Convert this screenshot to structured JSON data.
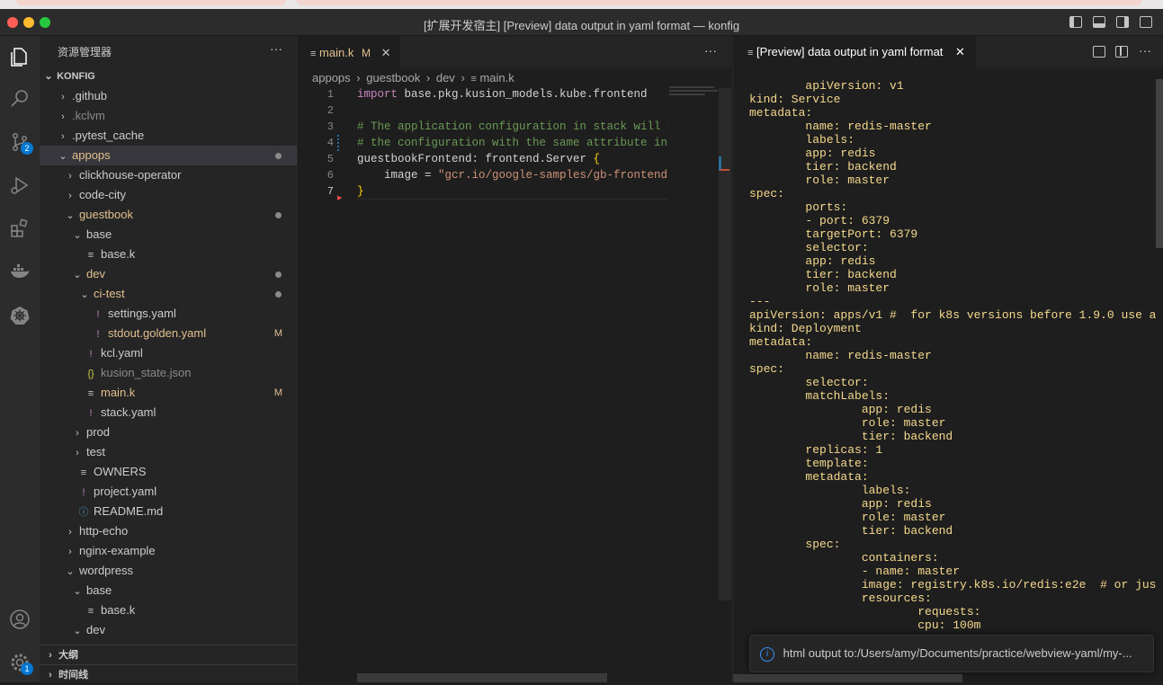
{
  "window": {
    "title": "[扩展开发宿主] [Preview] data output in yaml format — konfig"
  },
  "activity": {
    "scm_badge": "2",
    "settings_badge": "1"
  },
  "sidebar": {
    "header": "资源管理器",
    "root": "KONFIG",
    "tree": [
      {
        "label": ".github",
        "indent": 0,
        "kind": "folder",
        "open": false,
        "color": "#cccccc"
      },
      {
        "label": ".kclvm",
        "indent": 0,
        "kind": "folder",
        "open": false,
        "color": "#8b8b8b"
      },
      {
        "label": ".pytest_cache",
        "indent": 0,
        "kind": "folder",
        "open": false,
        "color": "#cccccc"
      },
      {
        "label": "appops",
        "indent": 0,
        "kind": "folder",
        "open": true,
        "color": "#e2c08d",
        "dot": true,
        "selected": true
      },
      {
        "label": "clickhouse-operator",
        "indent": 1,
        "kind": "folder",
        "open": false,
        "color": "#cccccc"
      },
      {
        "label": "code-city",
        "indent": 1,
        "kind": "folder",
        "open": false,
        "color": "#cccccc"
      },
      {
        "label": "guestbook",
        "indent": 1,
        "kind": "folder",
        "open": true,
        "color": "#e2c08d",
        "dot": true
      },
      {
        "label": "base",
        "indent": 2,
        "kind": "folder",
        "open": true,
        "color": "#cccccc"
      },
      {
        "label": "base.k",
        "indent": 3,
        "kind": "k",
        "color": "#cccccc"
      },
      {
        "label": "dev",
        "indent": 2,
        "kind": "folder",
        "open": true,
        "color": "#e2c08d",
        "dot": true
      },
      {
        "label": "ci-test",
        "indent": 3,
        "kind": "folder",
        "open": true,
        "color": "#e2c08d",
        "dot": true
      },
      {
        "label": "settings.yaml",
        "indent": 4,
        "kind": "yaml",
        "color": "#cccccc"
      },
      {
        "label": "stdout.golden.yaml",
        "indent": 4,
        "kind": "yaml",
        "color": "#e2c08d",
        "mark": "M"
      },
      {
        "label": "kcl.yaml",
        "indent": 3,
        "kind": "yaml",
        "color": "#cccccc"
      },
      {
        "label": "kusion_state.json",
        "indent": 3,
        "kind": "json",
        "color": "#8b8b8b"
      },
      {
        "label": "main.k",
        "indent": 3,
        "kind": "k",
        "color": "#e2c08d",
        "mark": "M"
      },
      {
        "label": "stack.yaml",
        "indent": 3,
        "kind": "yaml",
        "color": "#cccccc"
      },
      {
        "label": "prod",
        "indent": 2,
        "kind": "folder",
        "open": false,
        "color": "#cccccc"
      },
      {
        "label": "test",
        "indent": 2,
        "kind": "folder",
        "open": false,
        "color": "#cccccc"
      },
      {
        "label": "OWNERS",
        "indent": 2,
        "kind": "k",
        "color": "#cccccc"
      },
      {
        "label": "project.yaml",
        "indent": 2,
        "kind": "yaml",
        "color": "#cccccc"
      },
      {
        "label": "README.md",
        "indent": 2,
        "kind": "info",
        "color": "#cccccc"
      },
      {
        "label": "http-echo",
        "indent": 1,
        "kind": "folder",
        "open": false,
        "color": "#cccccc"
      },
      {
        "label": "nginx-example",
        "indent": 1,
        "kind": "folder",
        "open": false,
        "color": "#cccccc"
      },
      {
        "label": "wordpress",
        "indent": 1,
        "kind": "folder",
        "open": true,
        "color": "#cccccc"
      },
      {
        "label": "base",
        "indent": 2,
        "kind": "folder",
        "open": true,
        "color": "#cccccc"
      },
      {
        "label": "base.k",
        "indent": 3,
        "kind": "k",
        "color": "#cccccc"
      },
      {
        "label": "dev",
        "indent": 2,
        "kind": "folder",
        "open": true,
        "color": "#cccccc"
      }
    ],
    "outline_label": "大纲",
    "timeline_label": "时间线"
  },
  "editor": {
    "tab": {
      "label": "main.k",
      "mark": "M"
    },
    "breadcrumb": [
      "appops",
      "guestbook",
      "dev",
      "main.k"
    ],
    "lines": [
      {
        "n": "1",
        "html": "<span style=\"color:#c586c0\">import</span> base.pkg.kusion_models.kube.frontend"
      },
      {
        "n": "2",
        "html": ""
      },
      {
        "n": "3",
        "html": "<span style=\"color:#6a9955\"># The application configuration in stack will ov</span>"
      },
      {
        "n": "4",
        "html": "<span style=\"color:#6a9955\"># the configuration with the same attribute in b</span>"
      },
      {
        "n": "5",
        "html": "guestbookFrontend: frontend.Server <span style=\"color:#ffd700\">{</span>"
      },
      {
        "n": "6",
        "html": "    image = <span style=\"color:#ce9178\">\"gcr.io/google-samples/gb-frontend:v</span>"
      },
      {
        "n": "7",
        "html": "<span style=\"color:#ffd700\">}</span>"
      }
    ]
  },
  "preview": {
    "tab_label": "[Preview] data output in yaml format",
    "yaml_lines": [
      "        apiVersion: v1",
      "kind: Service",
      "metadata:",
      "        name: redis-master",
      "        labels:",
      "        app: redis",
      "        tier: backend",
      "        role: master",
      "spec:",
      "        ports:",
      "        - port: 6379",
      "        targetPort: 6379",
      "        selector:",
      "        app: redis",
      "        tier: backend",
      "        role: master",
      "---",
      "apiVersion: apps/v1 #  for k8s versions before 1.9.0 use a",
      "kind: Deployment",
      "metadata:",
      "        name: redis-master",
      "spec:",
      "        selector:",
      "        matchLabels:",
      "                app: redis",
      "                role: master",
      "                tier: backend",
      "        replicas: 1",
      "        template:",
      "        metadata:",
      "                labels:",
      "                app: redis",
      "                role: master",
      "                tier: backend",
      "        spec:",
      "                containers:",
      "                - name: master",
      "                image: registry.k8s.io/redis:e2e  # or jus",
      "                resources:",
      "                        requests:",
      "                        cpu: 100m"
    ],
    "notification": "html output to:/Users/amy/Documents/practice/webview-yaml/my-..."
  },
  "colors": {
    "accent": "#0078d4",
    "modified": "#e2c08d",
    "yaml_text": "#f5d98c"
  }
}
